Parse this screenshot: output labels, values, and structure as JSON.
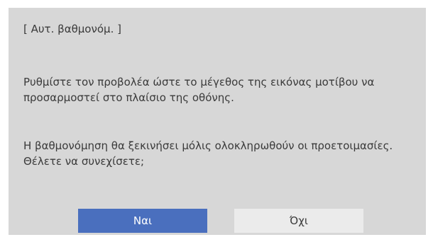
{
  "dialog": {
    "title": "[ Αυτ. βαθμονόμ. ]",
    "message_1": "Ρυθμίστε τον προβολέα ώστε το μέγεθος της εικόνας μοτίβου να προσαρμοστεί στο πλαίσιο της οθόνης.",
    "message_2": "Η βαθμονόμηση θα ξεκινήσει μόλις ολοκληρωθούν οι προετοιμασίες. Θέλετε να συνεχίσετε;",
    "yes_label": "Ναι",
    "no_label": "Όχι",
    "selected_button": "yes"
  },
  "colors": {
    "dialog_background": "#d7d7d7",
    "selected_button": "#4a6fbe",
    "unselected_button": "#ebebeb",
    "text": "#3a3a3a"
  }
}
